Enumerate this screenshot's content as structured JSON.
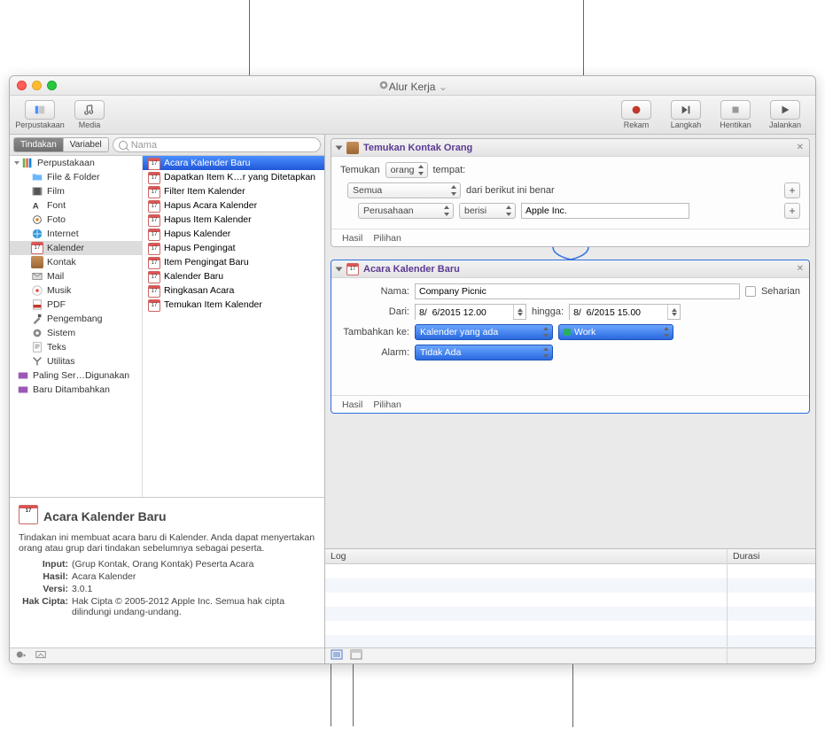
{
  "window": {
    "title": "Alur Kerja"
  },
  "toolbar": {
    "library": "Perpustakaan",
    "media": "Media",
    "record": "Rekam",
    "step": "Langkah",
    "stop": "Hentikan",
    "run": "Jalankan"
  },
  "seg": {
    "actions": "Tindakan",
    "variables": "Variabel"
  },
  "search": {
    "placeholder": "Nama"
  },
  "library_tree": {
    "root": "Perpustakaan",
    "items": [
      "File & Folder",
      "Film",
      "Font",
      "Foto",
      "Internet",
      "Kalender",
      "Kontak",
      "Mail",
      "Musik",
      "PDF",
      "Pengembang",
      "Sistem",
      "Teks",
      "Utilitas"
    ],
    "extras": [
      "Paling Ser…Digunakan",
      "Baru Ditambahkan"
    ]
  },
  "action_list": [
    "Acara Kalender Baru",
    "Dapatkan Item K…r yang Ditetapkan",
    "Filter Item Kalender",
    "Hapus Acara Kalender",
    "Hapus Item Kalender",
    "Hapus Kalender",
    "Hapus Pengingat",
    "Item Pengingat Baru",
    "Kalender Baru",
    "Ringkasan Acara",
    "Temukan Item Kalender"
  ],
  "info": {
    "title": "Acara Kalender Baru",
    "desc": "Tindakan ini membuat acara baru di Kalender. Anda dapat menyertakan orang atau grup dari tindakan sebelumnya sebagai peserta.",
    "k_input": "Input:",
    "v_input": "(Grup Kontak, Orang Kontak) Peserta Acara",
    "k_result": "Hasil:",
    "v_result": "Acara Kalender",
    "k_version": "Versi:",
    "v_version": "3.0.1",
    "k_copy": "Hak Cipta:",
    "v_copy": "Hak Cipta © 2005-2012 Apple Inc.  Semua hak cipta dilindungi undang-undang."
  },
  "wf1": {
    "title": "Temukan Kontak Orang",
    "find": "Temukan",
    "people": "orang",
    "where": "tempat:",
    "all": "Semua",
    "true": "dari berikut ini benar",
    "company": "Perusahaan",
    "contains": "berisi",
    "value": "Apple Inc.",
    "results": "Hasil",
    "options": "Pilihan"
  },
  "wf2": {
    "title": "Acara Kalender Baru",
    "name_l": "Nama:",
    "name_v": "Company Picnic",
    "allday": "Seharian",
    "from_l": "Dari:",
    "from_v": "8/  6/2015 12.00",
    "to_l": "hingga:",
    "to_v": "8/  6/2015 15.00",
    "add_l": "Tambahkan ke:",
    "add_v": "Kalender yang ada",
    "cal": "Work",
    "alarm_l": "Alarm:",
    "alarm_v": "Tidak Ada",
    "results": "Hasil",
    "options": "Pilihan"
  },
  "log": {
    "log": "Log",
    "duration": "Durasi"
  }
}
